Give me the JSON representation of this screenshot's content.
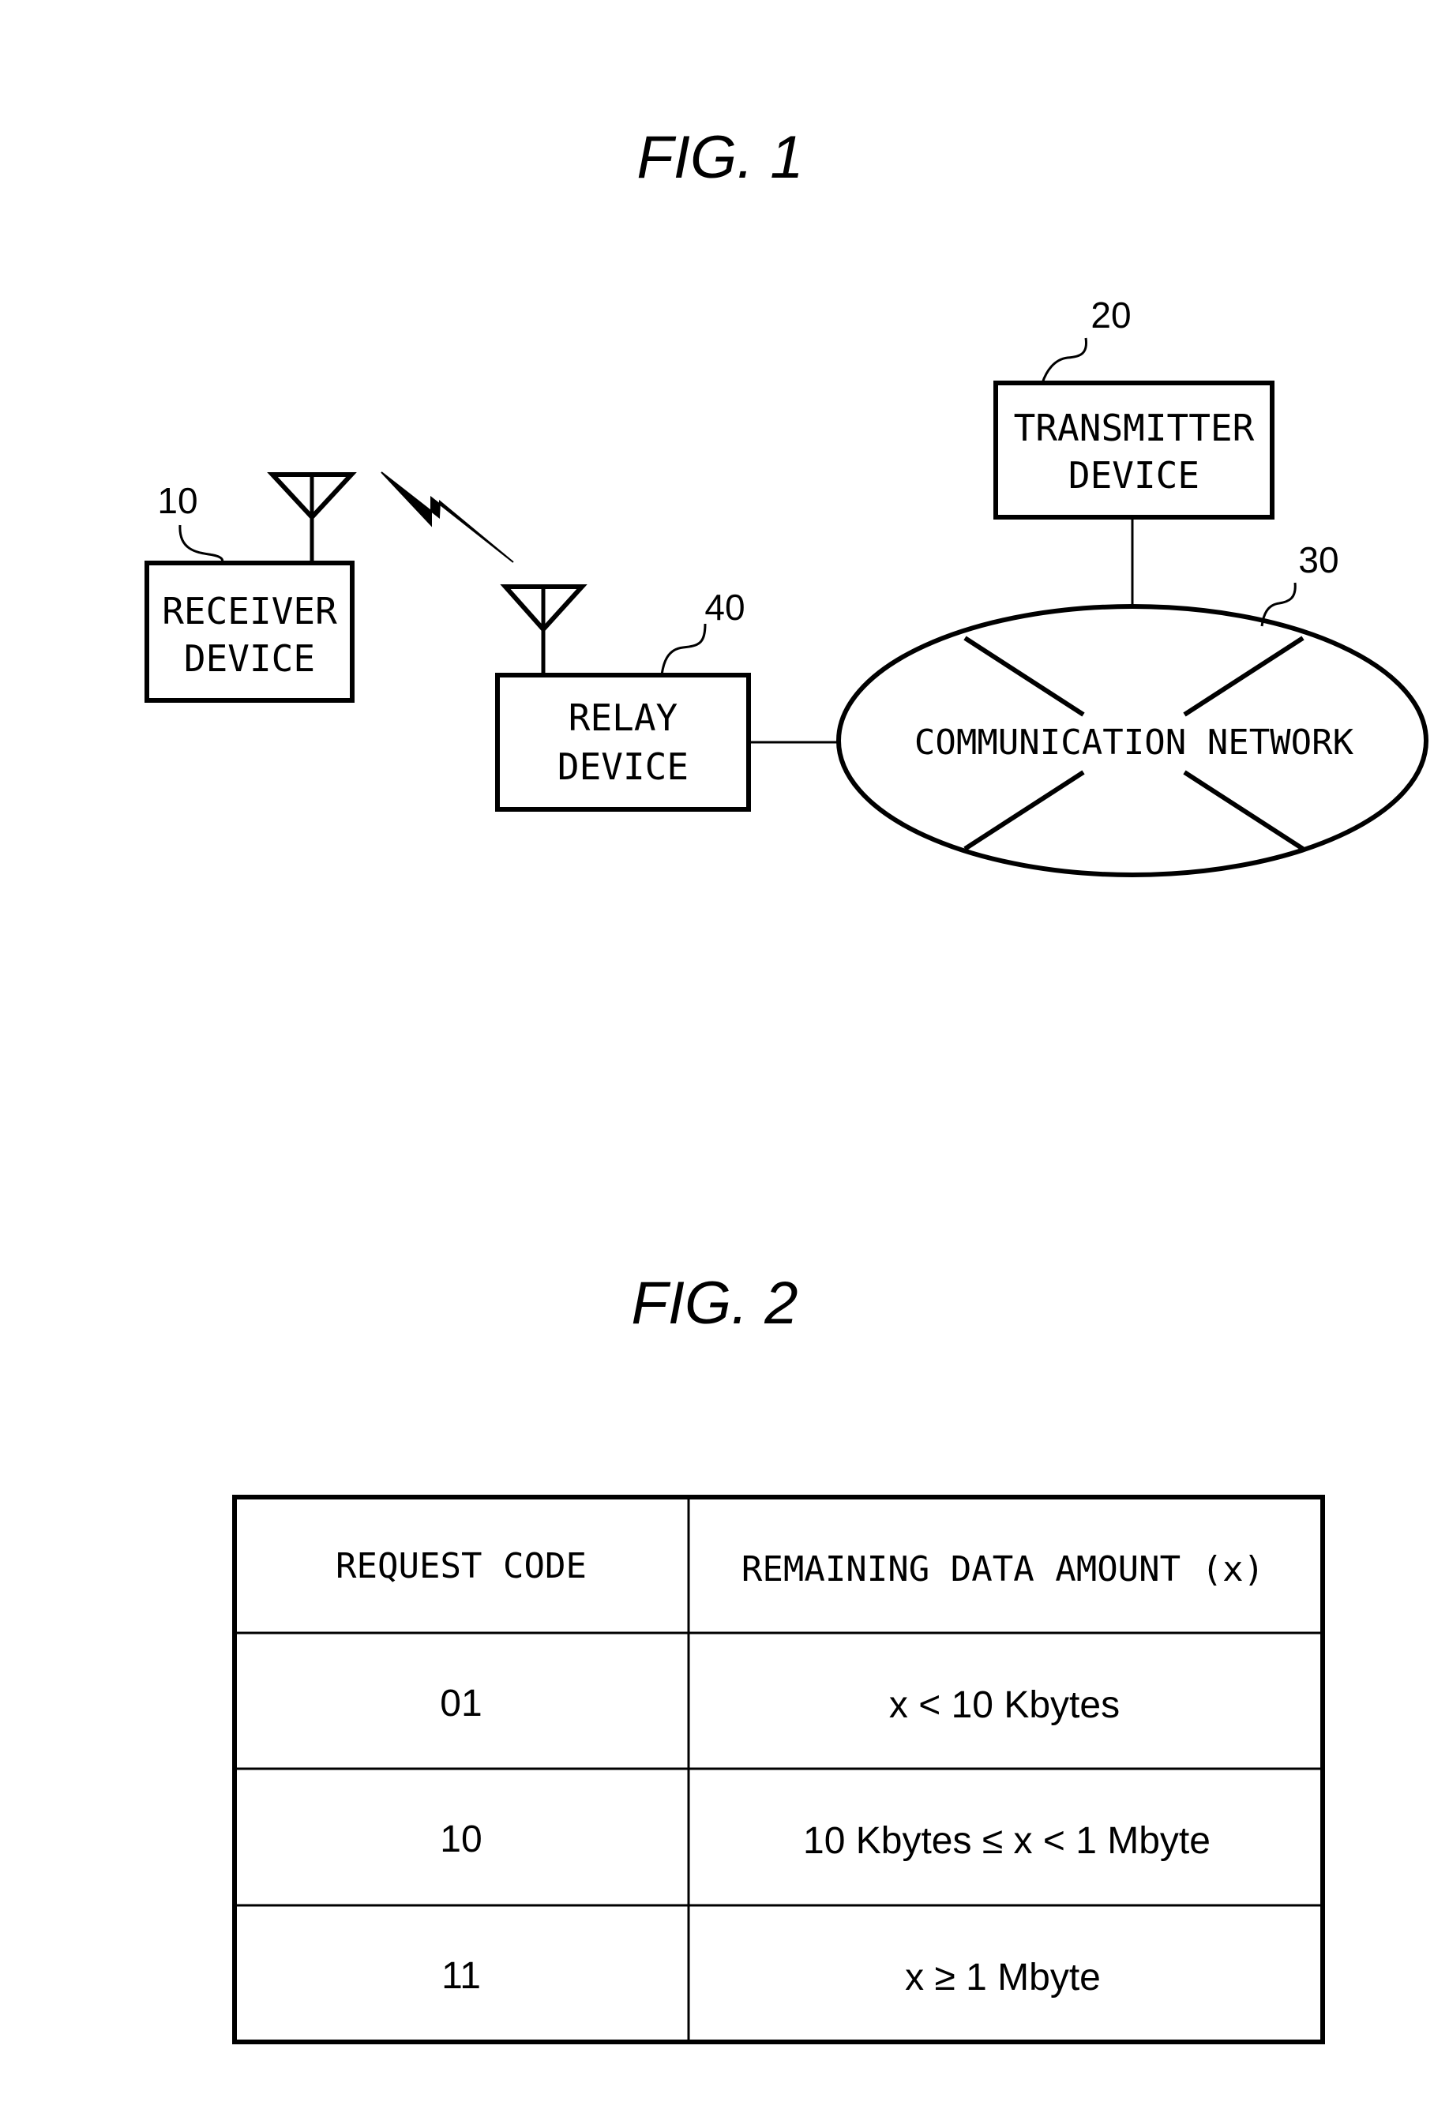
{
  "fig1": {
    "title": "FIG. 1",
    "receiver": {
      "ref": "10",
      "line1": "RECEIVER",
      "line2": "DEVICE"
    },
    "relay": {
      "ref": "40",
      "line1": "RELAY",
      "line2": "DEVICE"
    },
    "transmitter": {
      "ref": "20",
      "line1": "TRANSMITTER",
      "line2": "DEVICE"
    },
    "network": {
      "ref": "30",
      "label": "COMMUNICATION NETWORK"
    },
    "icons": [
      "antenna-icon",
      "antenna-icon",
      "wireless-link-icon"
    ]
  },
  "fig2": {
    "title": "FIG. 2",
    "table": {
      "headers": [
        "REQUEST CODE",
        "REMAINING DATA AMOUNT (x)"
      ],
      "rows": [
        {
          "code": "01",
          "amount": "x < 10 Kbytes"
        },
        {
          "code": "10",
          "amount": "10 Kbytes ≤ x < 1 Mbyte"
        },
        {
          "code": "11",
          "amount": "x ≥ 1 Mbyte"
        }
      ]
    }
  }
}
